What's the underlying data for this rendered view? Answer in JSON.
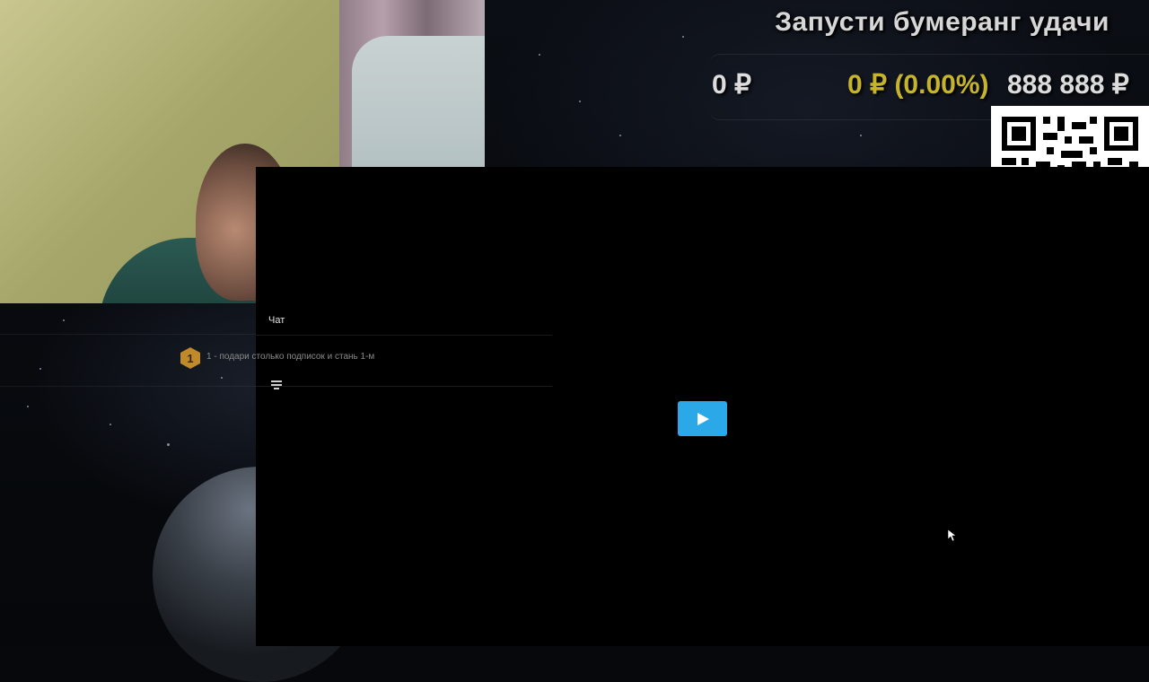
{
  "overlay": {
    "title": "Запусти бумеранг удачи",
    "donation": {
      "current": "0 ₽",
      "progress": "0 ₽ (0.00%)",
      "goal": "888 888 ₽",
      "progress_color": "#c6b42a"
    }
  },
  "top_chat": {
    "rank_badge": "1",
    "ticker": "1 - подари столько подписок и стань 1-м"
  },
  "chat": {
    "label": "Чат",
    "filter_icon": "filter-lines-icon"
  },
  "video": {
    "play_icon": "play-icon",
    "accent": "#2aa8e8"
  }
}
